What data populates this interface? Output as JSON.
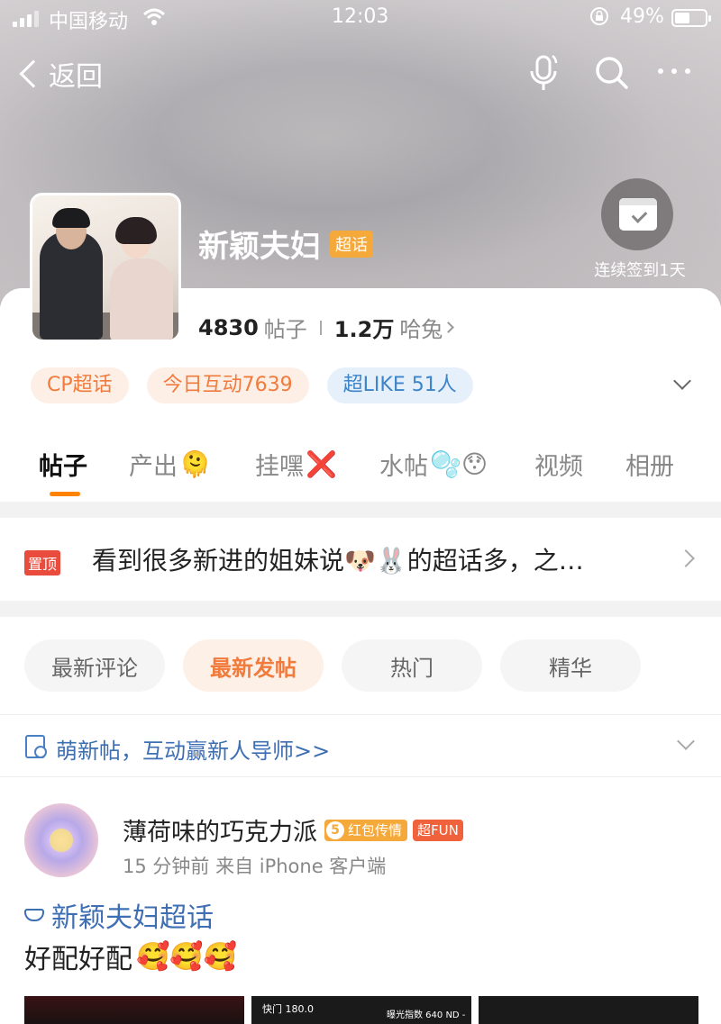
{
  "status_bar": {
    "carrier": "中国移动",
    "time": "12:03",
    "battery_pct": "49%",
    "battery_level": 0.49
  },
  "nav": {
    "back_label": "返回",
    "icons": [
      "microphone-icon",
      "search-icon",
      "more-icon"
    ]
  },
  "topic": {
    "name": "新颖夫妇",
    "tag": "超话",
    "posts_count": "4830",
    "posts_label": "帖子",
    "followers_count": "1.2万",
    "followers_label": "哈兔",
    "checkin_label": "连续签到1天"
  },
  "chips": [
    {
      "label": "CP超话"
    },
    {
      "label": "今日互动7639"
    },
    {
      "label": "超LIKE 51人"
    }
  ],
  "tabs": [
    {
      "label": "帖子",
      "emoji": "",
      "active": true
    },
    {
      "label": "产出",
      "emoji": "🫠"
    },
    {
      "label": "挂嘿",
      "emoji": "❌"
    },
    {
      "label": "水帖",
      "emoji": "🫧😯"
    },
    {
      "label": "视频",
      "emoji": ""
    },
    {
      "label": "相册",
      "emoji": ""
    }
  ],
  "pinned": {
    "badge": "置顶",
    "text": "看到很多新进的姐妹说🐶🐰的超话多，之…"
  },
  "filters": [
    {
      "label": "最新评论"
    },
    {
      "label": "最新发帖",
      "active": true
    },
    {
      "label": "热门"
    },
    {
      "label": "精华"
    }
  ],
  "newbie": {
    "text": "萌新帖，互动赢新人导师>>"
  },
  "post": {
    "author": "薄荷味的巧克力派",
    "badge_level": "5",
    "badge_text": "红包传情",
    "badge_fun": "超FUN",
    "meta": "15 分钟前  来自 iPhone 客户端",
    "topic": "新颖夫妇超话",
    "body": "好配好配",
    "emojis": "🥰🥰🥰",
    "thumb_caption_1": "快门 180.0",
    "thumb_caption_2": "曝光指数 640  ND -"
  }
}
